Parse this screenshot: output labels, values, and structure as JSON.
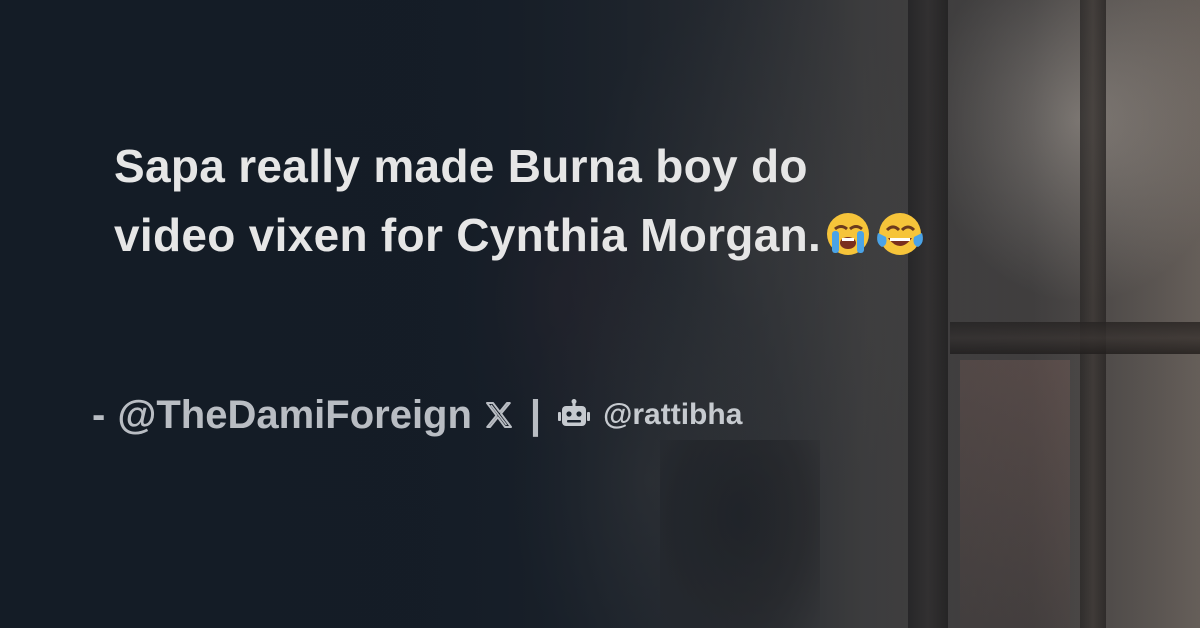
{
  "quote": {
    "line1": "Sapa really made Burna boy do",
    "line2": "video vixen for Cynthia Morgan.",
    "emojis": [
      "loudly-crying-face-emoji",
      "face-with-tears-of-joy-emoji"
    ]
  },
  "attribution": {
    "dash": "-",
    "author": "@TheDamiForeign",
    "platform_icon": "x-logo-icon",
    "separator": "|",
    "bot_icon": "robot-icon",
    "site": "@rattibha"
  },
  "colors": {
    "background": "#141c26",
    "quote_text": "#e6e6e6",
    "attribution_text": "#b9bdc3"
  }
}
